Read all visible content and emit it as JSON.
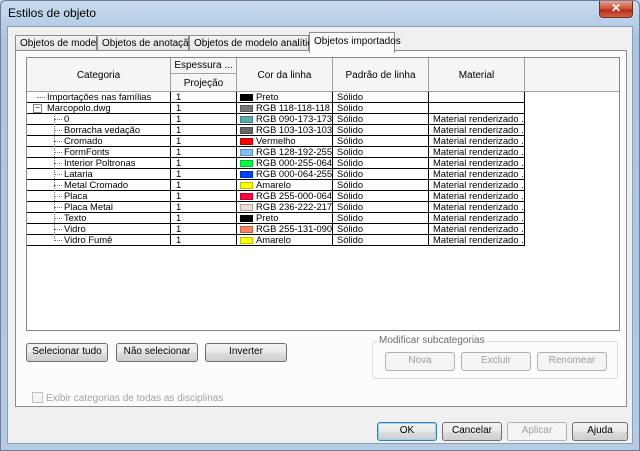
{
  "window": {
    "title": "Estilos de objeto",
    "close_label": "✕"
  },
  "tabs": [
    {
      "label": "Objetos de modelo",
      "active": false
    },
    {
      "label": "Objetos de anotação",
      "active": false
    },
    {
      "label": "Objetos de modelo analítico",
      "active": false
    },
    {
      "label": "Objetos importados",
      "active": true
    }
  ],
  "table": {
    "headers": {
      "categoria": "Categoria",
      "espessura": "Espessura ...",
      "projecao": "Projeção",
      "cor": "Cor da linha",
      "padrao": "Padrão de linha",
      "material": "Material"
    },
    "rows": [
      {
        "name": "Importações nas famílias",
        "level": 0,
        "thickness": "1",
        "color_name": "Preto",
        "color_hex": "#000000",
        "pattern": "Sólido",
        "material": ""
      },
      {
        "name": "Marcopolo.dwg",
        "level": 0,
        "expanded": true,
        "thickness": "1",
        "color_name": "RGB 118-118-118",
        "color_hex": "#767676",
        "pattern": "Sólido",
        "material": ""
      },
      {
        "name": "0",
        "level": 1,
        "thickness": "1",
        "color_name": "RGB 090-173-173",
        "color_hex": "#5aadad",
        "pattern": "Sólido",
        "material": "Material renderizado ..."
      },
      {
        "name": "Borracha vedação",
        "level": 1,
        "thickness": "1",
        "color_name": "RGB 103-103-103",
        "color_hex": "#676767",
        "pattern": "Sólido",
        "material": "Material renderizado ..."
      },
      {
        "name": "Cromado",
        "level": 1,
        "thickness": "1",
        "color_name": "Vermelho",
        "color_hex": "#ff0000",
        "pattern": "Sólido",
        "material": "Material renderizado ..."
      },
      {
        "name": "FormFonts",
        "level": 1,
        "thickness": "1",
        "color_name": "RGB 128-192-255",
        "color_hex": "#80c0ff",
        "pattern": "Sólido",
        "material": "Material renderizado ..."
      },
      {
        "name": "Interior Poltronas",
        "level": 1,
        "thickness": "1",
        "color_name": "RGB 000-255-064",
        "color_hex": "#00ff40",
        "pattern": "Sólido",
        "material": "Material renderizado ..."
      },
      {
        "name": "Lataria",
        "level": 1,
        "thickness": "1",
        "color_name": "RGB 000-064-255",
        "color_hex": "#0040ff",
        "pattern": "Sólido",
        "material": "Material renderizado ..."
      },
      {
        "name": "Metal Cromado",
        "level": 1,
        "thickness": "1",
        "color_name": "Amarelo",
        "color_hex": "#ffff00",
        "pattern": "Sólido",
        "material": "Material renderizado ..."
      },
      {
        "name": "Placa",
        "level": 1,
        "thickness": "1",
        "color_name": "RGB 255-000-064",
        "color_hex": "#ff0040",
        "pattern": "Sólido",
        "material": "Material renderizado ..."
      },
      {
        "name": "Placa Metal",
        "level": 1,
        "thickness": "1",
        "color_name": "RGB 236-222-217",
        "color_hex": "#ecded9",
        "pattern": "Sólido",
        "material": "Material renderizado ..."
      },
      {
        "name": "Texto",
        "level": 1,
        "thickness": "1",
        "color_name": "Preto",
        "color_hex": "#000000",
        "pattern": "Sólido",
        "material": "Material renderizado ..."
      },
      {
        "name": "Vidro",
        "level": 1,
        "thickness": "1",
        "color_name": "RGB 255-131-090",
        "color_hex": "#ff835a",
        "pattern": "Sólido",
        "material": "Material renderizado ..."
      },
      {
        "name": "Vidro Fumê",
        "level": 1,
        "thickness": "1",
        "color_name": "Amarelo",
        "color_hex": "#ffff00",
        "pattern": "Sólido",
        "material": "Material renderizado ..."
      }
    ]
  },
  "buttons": {
    "select_all": "Selecionar tudo",
    "select_none": "Não selecionar",
    "invert": "Inverter"
  },
  "checkbox": {
    "label": "Exibir categorias de todas as disciplinas",
    "checked": false
  },
  "subcategories": {
    "title": "Modificar subcategorias",
    "new": "Nova",
    "delete": "Excluir",
    "rename": "Renomear"
  },
  "footer": {
    "ok": "OK",
    "cancel": "Cancelar",
    "apply": "Aplicar",
    "help": "Ajuda"
  }
}
